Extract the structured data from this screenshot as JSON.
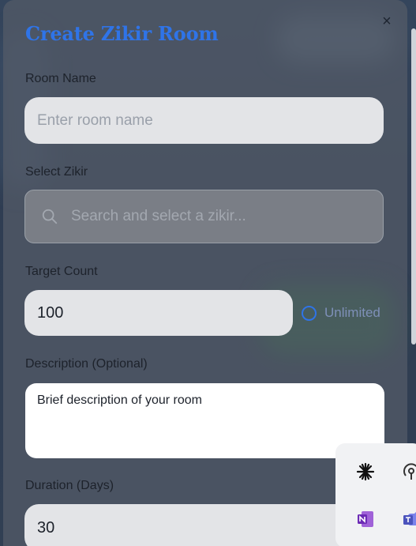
{
  "modal": {
    "title": "Create Zikir Room",
    "close_label": "×",
    "colors": {
      "accent": "#2f74e8"
    }
  },
  "room_name": {
    "label": "Room Name",
    "placeholder": "Enter room name"
  },
  "zikir": {
    "label": "Select Zikir",
    "placeholder": "Search and select a zikir...",
    "icon": "search-icon"
  },
  "target": {
    "label": "Target Count",
    "value": "100",
    "unlimited_label": "Unlimited"
  },
  "description": {
    "label": "Description (Optional)",
    "placeholder": "Brief description of your room"
  },
  "duration": {
    "label": "Duration (Days)",
    "value": "30"
  },
  "tray": {
    "icons": [
      "asterisk-app-icon",
      "podcast-icon",
      "onenote-icon",
      "teams-icon"
    ]
  }
}
